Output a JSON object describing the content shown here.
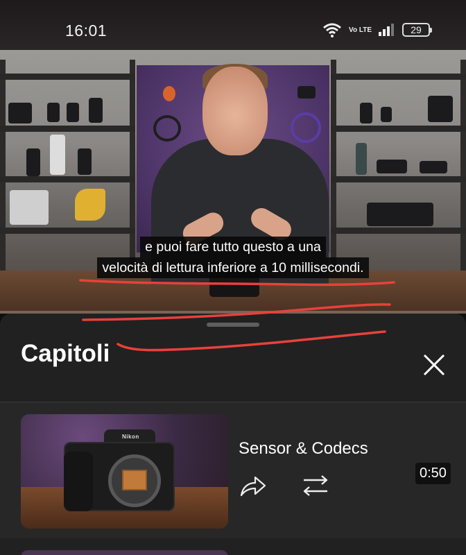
{
  "status_bar": {
    "time": "16:01",
    "network_label": "Vo LTE",
    "battery_level": "29",
    "icons": [
      "wifi-icon",
      "volte-icon",
      "signal-icon",
      "battery-icon"
    ]
  },
  "video": {
    "caption_line1": "e puoi fare tutto questo a una",
    "caption_line2": "velocità di lettura inferiore a 10 millisecondi."
  },
  "chapters_panel": {
    "title": "Capitoli",
    "close_icon": "close-icon",
    "chapters": [
      {
        "title": "Sensor & Codecs",
        "timestamp": "0:50",
        "thumb_logo": "Nikon",
        "actions": [
          "share-icon",
          "loop-icon"
        ]
      }
    ]
  },
  "colors": {
    "panel_bg": "#212121",
    "chapter_bg": "#272727",
    "annotation_red": "#e8413b"
  }
}
